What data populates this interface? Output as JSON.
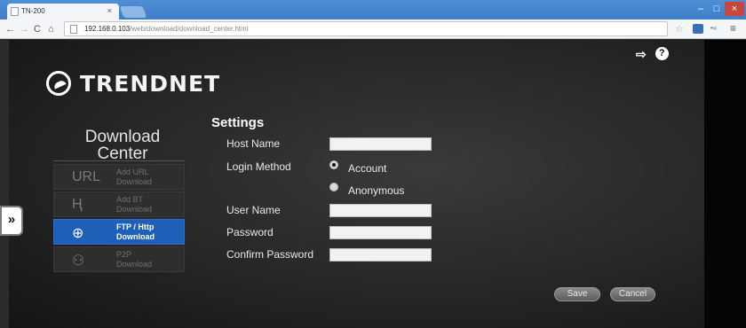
{
  "browser": {
    "tab_title": "TN-200",
    "tab_close": "×",
    "url_host": "192.168.0.103",
    "url_path": "/web/download/download_center.html",
    "nav_back": "←",
    "nav_forward": "→",
    "nav_reload": "C",
    "nav_home": "⌂",
    "star": "☆",
    "ext2": "•«",
    "menu": "≡",
    "win_min": "–",
    "win_max": "□",
    "win_close": "×"
  },
  "header": {
    "logo_text": "TRENDNET",
    "logout_icon": "⇨",
    "help_icon": "?"
  },
  "sidebar": {
    "title_line1": "Download",
    "title_line2": "Center",
    "expand": "»",
    "items": [
      {
        "icon": "URL",
        "line1": "Add URL",
        "line2": "Download",
        "active": false
      },
      {
        "icon": "Ⱨ",
        "line1": "Add BT",
        "line2": "Download",
        "active": false
      },
      {
        "icon": "⊕",
        "line1": "FTP / Http",
        "line2": "Download",
        "active": true
      },
      {
        "icon": "⚇",
        "line1": "P2P",
        "line2": "Download",
        "active": false
      }
    ]
  },
  "settings": {
    "title": "Settings",
    "host_name_label": "Host Name",
    "host_name_value": "",
    "login_method_label": "Login Method",
    "login_options": [
      "Account",
      "Anonymous"
    ],
    "login_selected": "Account",
    "user_name_label": "User Name",
    "user_name_value": "",
    "password_label": "Password",
    "password_value": "",
    "confirm_password_label": "Confirm Password",
    "confirm_password_value": ""
  },
  "actions": {
    "save": "Save",
    "cancel": "Cancel"
  }
}
